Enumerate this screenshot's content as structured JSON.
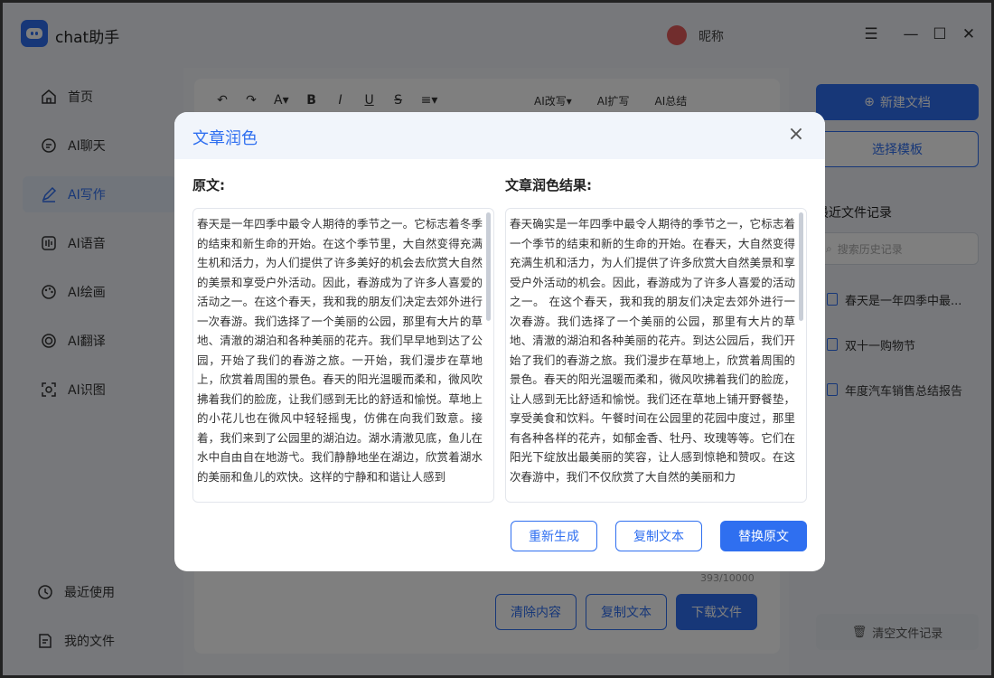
{
  "app": {
    "title": "chat助手",
    "user_name": "昵称"
  },
  "window_controls": {
    "menu": "☰",
    "minimize": "—",
    "maximize": "☐",
    "close": "✕"
  },
  "sidebar": {
    "items": [
      {
        "label": "首页",
        "icon": "home-icon"
      },
      {
        "label": "AI聊天",
        "icon": "chat-icon"
      },
      {
        "label": "AI写作",
        "icon": "pen-icon",
        "active": true
      },
      {
        "label": "AI语音",
        "icon": "voice-icon"
      },
      {
        "label": "AI绘画",
        "icon": "palette-icon"
      },
      {
        "label": "AI翻译",
        "icon": "translate-icon"
      },
      {
        "label": "AI识图",
        "icon": "scan-icon"
      }
    ],
    "bottom": [
      {
        "label": "最近使用",
        "icon": "history-icon"
      },
      {
        "label": "我的文件",
        "icon": "file-icon"
      }
    ]
  },
  "editor": {
    "toolbar": {
      "undo": "↶",
      "redo": "↷",
      "font_color": "A▾",
      "bold": "B",
      "italic": "I",
      "underline": "U",
      "strike": "S",
      "align": "≡▾"
    },
    "ai_tools": {
      "rewrite": "AI改写▾",
      "expand": "AI扩写",
      "summary": "AI总结"
    },
    "count": "393/10000",
    "buttons": {
      "clear": "清除内容",
      "copy": "复制文本",
      "download": "下载文件"
    }
  },
  "right_panel": {
    "new_doc": "新建文档",
    "template": "选择模板",
    "recent_title": "最近文件记录",
    "search_placeholder": "搜索历史记录",
    "recent_items": [
      "春天是一年四季中最...",
      "双十一购物节",
      "年度汽车销售总结报告"
    ],
    "clear_records": "清空文件记录"
  },
  "modal": {
    "title": "文章润色",
    "close": "×",
    "original_label": "原文:",
    "result_label": "文章润色结果:",
    "original_text": "春天是一年四季中最令人期待的季节之一。它标志着冬季的结束和新生命的开始。在这个季节里，大自然变得充满生机和活力，为人们提供了许多美好的机会去欣赏大自然的美景和享受户外活动。因此，春游成为了许多人喜爱的活动之一。在这个春天，我和我的朋友们决定去郊外进行一次春游。我们选择了一个美丽的公园，那里有大片的草地、清澈的湖泊和各种美丽的花卉。我们早早地到达了公园，开始了我们的春游之旅。一开始，我们漫步在草地上，欣赏着周围的景色。春天的阳光温暖而柔和，微风吹拂着我们的脸庞，让我们感到无比的舒适和愉悦。草地上的小花儿也在微风中轻轻摇曳，仿佛在向我们致意。接着，我们来到了公园里的湖泊边。湖水清澈见底，鱼儿在水中自由自在地游弋。我们静静地坐在湖边，欣赏着湖水的美丽和鱼儿的欢快。这样的宁静和和谐让人感到",
    "result_text": "春天确实是一年四季中最令人期待的季节之一，它标志着一个季节的结束和新的生命的开始。在春天，大自然变得充满生机和活力，为人们提供了许多欣赏大自然美景和享受户外活动的机会。因此，春游成为了许多人喜爱的活动之一。 在这个春天，我和我的朋友们决定去郊外进行一次春游。我们选择了一个美丽的公园，那里有大片的草地、清澈的湖泊和各种美丽的花卉。到达公园后，我们开始了我们的春游之旅。我们漫步在草地上，欣赏着周围的景色。春天的阳光温暖而柔和，微风吹拂着我们的脸庞，让人感到无比舒适和愉悦。我们还在草地上铺开野餐垫，享受美食和饮料。午餐时间在公园里的花园中度过，那里有各种各样的花卉，如郁金香、牡丹、玫瑰等等。它们在阳光下绽放出最美丽的笑容，让人感到惊艳和赞叹。在这次春游中，我们不仅欣赏了大自然的美丽和力",
    "buttons": {
      "regenerate": "重新生成",
      "copy": "复制文本",
      "replace": "替换原文"
    }
  },
  "colors": {
    "accent": "#2f6ff0",
    "overlay": "rgba(0,0,0,0.5)"
  }
}
